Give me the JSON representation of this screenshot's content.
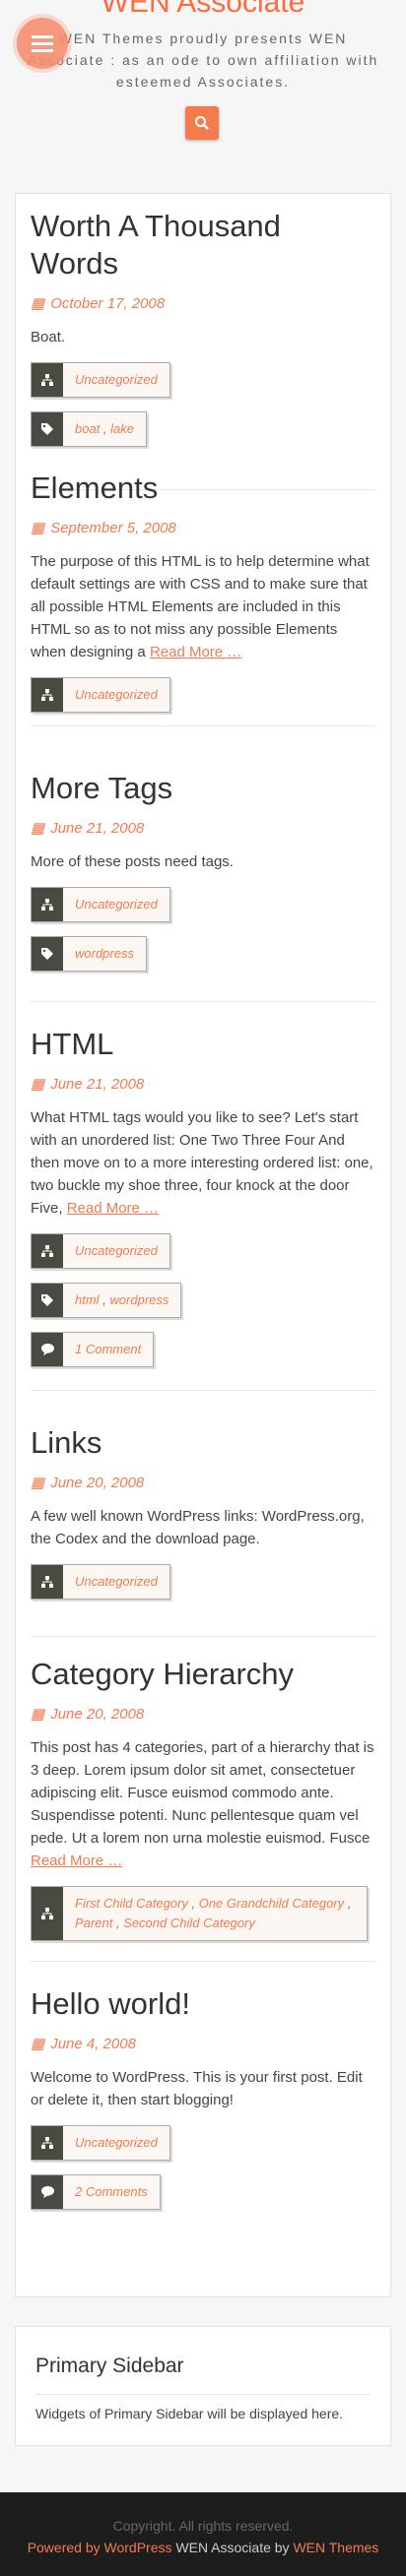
{
  "site": {
    "title": "WEN Associate",
    "tagline": "WEN Themes proudly presents WEN Associate : as an ode to own affiliation with esteemed Associates."
  },
  "colors": {
    "accent": "#f57a4e",
    "dark": "#4a4a42",
    "footer_bg": "#1d1d1d"
  },
  "posts": [
    {
      "title": "Worth A Thousand Words",
      "date": "October 17, 2008",
      "excerpt": "Boat.",
      "categories": [
        "Uncategorized"
      ],
      "tags": [
        "boat",
        "lake"
      ]
    },
    {
      "title": "Elements",
      "date": "September 5, 2008",
      "excerpt": "The purpose of this HTML is to help determine what default settings are with CSS and to make sure that all possible HTML Elements are included in this HTML so as to not miss any possible Elements when designing a",
      "read_more": "Read More …",
      "categories": [
        "Uncategorized"
      ]
    },
    {
      "title": "More Tags",
      "date": "June 21, 2008",
      "excerpt": "More of these posts need tags.",
      "categories": [
        "Uncategorized"
      ],
      "tags": [
        "wordpress"
      ]
    },
    {
      "title": "HTML",
      "date": "June 21, 2008",
      "excerpt": "What HTML tags would you like to see? Let's start with an unordered list: One Two Three Four And then move on to a more interesting ordered list: one, two buckle my shoe three, four knock at the door Five,",
      "read_more": "Read More …",
      "categories": [
        "Uncategorized"
      ],
      "tags": [
        "html",
        "wordpress"
      ],
      "comments": "1 Comment"
    },
    {
      "title": "Links",
      "date": "June 20, 2008",
      "excerpt": "A few well known WordPress links: WordPress.org, the Codex and the download page.",
      "categories": [
        "Uncategorized"
      ]
    },
    {
      "title": "Category Hierarchy",
      "date": "June 20, 2008",
      "excerpt": "This post has 4 categories, part of a hierarchy that is 3 deep. Lorem ipsum dolor sit amet, consectetuer adipiscing elit. Fusce euismod commodo ante. Suspendisse potenti. Nunc pellentesque quam vel pede. Ut a lorem non urna molestie euismod. Fusce",
      "read_more": "Read More …",
      "categories": [
        "First Child Category",
        "One Grandchild Category",
        "Parent",
        "Second Child Category"
      ]
    },
    {
      "title": "Hello world!",
      "date": "June 4, 2008",
      "excerpt": "Welcome to WordPress. This is your first post. Edit or delete it, then start blogging!",
      "categories": [
        "Uncategorized"
      ],
      "comments": "2 Comments"
    }
  ],
  "sidebar": {
    "title": "Primary Sidebar",
    "text": "Widgets of Primary Sidebar will be displayed here."
  },
  "footer": {
    "copyright": "Copyright. All rights reserved.",
    "powered_prefix": "Powered by",
    "powered_link": "WordPress",
    "theme_text": "WEN Associate by",
    "theme_link": "WEN Themes"
  }
}
